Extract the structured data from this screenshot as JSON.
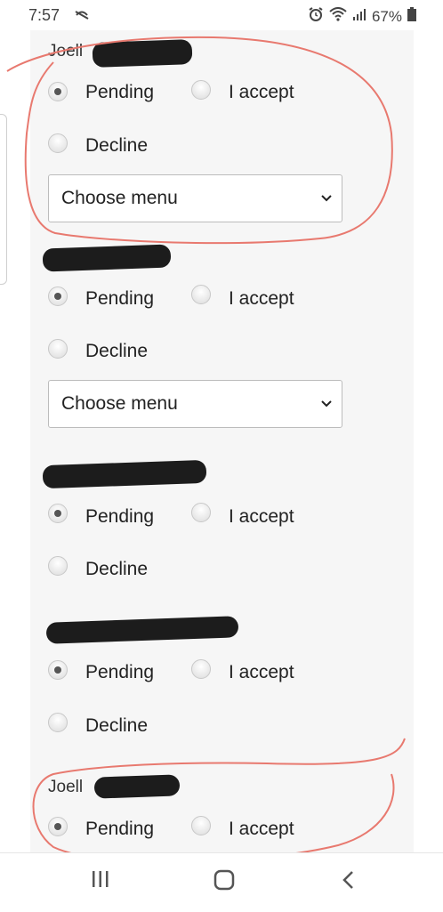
{
  "status_bar": {
    "time": "7:57",
    "battery": "67%"
  },
  "form": {
    "entries": [
      {
        "name": "Joell",
        "options": {
          "pending": "Pending",
          "accept": "I accept",
          "decline": "Decline"
        },
        "menu": "Choose menu"
      },
      {
        "name": "",
        "options": {
          "pending": "Pending",
          "accept": "I accept",
          "decline": "Decline"
        },
        "menu": "Choose menu"
      },
      {
        "name": "",
        "options": {
          "pending": "Pending",
          "accept": "I accept",
          "decline": "Decline"
        }
      },
      {
        "name": "",
        "options": {
          "pending": "Pending",
          "accept": "I accept",
          "decline": "Decline"
        }
      },
      {
        "name": "Joell",
        "options": {
          "pending": "Pending",
          "accept": "I accept"
        }
      }
    ]
  },
  "colors": {
    "annotation": "#e8796f",
    "redaction": "#1c1c1c",
    "card": "#f6f6f6"
  }
}
